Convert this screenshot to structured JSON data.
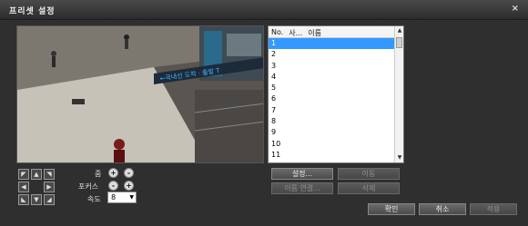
{
  "window": {
    "title": "프리셋 설정",
    "close_label": "×"
  },
  "list": {
    "headers": [
      "No.",
      "사...",
      "이름"
    ],
    "rows": [
      "1",
      "2",
      "3",
      "4",
      "5",
      "6",
      "7",
      "8",
      "9",
      "10",
      "11"
    ],
    "selected_index": 0
  },
  "ptz": {
    "arrows": [
      "◤",
      "▲",
      "◥",
      "◀",
      "▶",
      "◣",
      "▼",
      "◢"
    ]
  },
  "controls": {
    "zoom_label": "줌",
    "focus_label": "포커스",
    "speed_label": "속도",
    "speed_value": "8",
    "zoom_in": "+",
    "zoom_out": "-",
    "focus_near": "-",
    "focus_far": "+"
  },
  "buttons": {
    "set": "설정...",
    "move": "이동",
    "name_link": "이름 연결...",
    "delete": "삭제",
    "ok": "확인",
    "cancel": "취소",
    "apply": "적용"
  },
  "colors": {
    "accent": "#3399ff"
  },
  "video_overlay": {
    "sign_text": "←국내선 도착 · 출발 T"
  }
}
